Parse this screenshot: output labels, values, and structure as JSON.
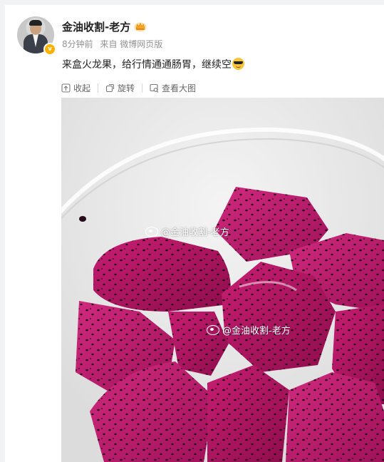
{
  "post": {
    "username": "金油收割-老方",
    "time": "8分钟前",
    "source": "来自 微博网页版",
    "text": "来盒火龙果，给行情通通肠胃，继续空",
    "emoji": "cool-sunglasses-emoji"
  },
  "toolbar": {
    "collapse_label": "收起",
    "rotate_label": "旋转",
    "view_large_label": "查看大图"
  },
  "image": {
    "subject": "dragon-fruit-photo",
    "watermark": "@金油收割-老方"
  },
  "colors": {
    "badge": "#ffb100",
    "fruit": "#b0165f",
    "meta_text": "#939393"
  }
}
